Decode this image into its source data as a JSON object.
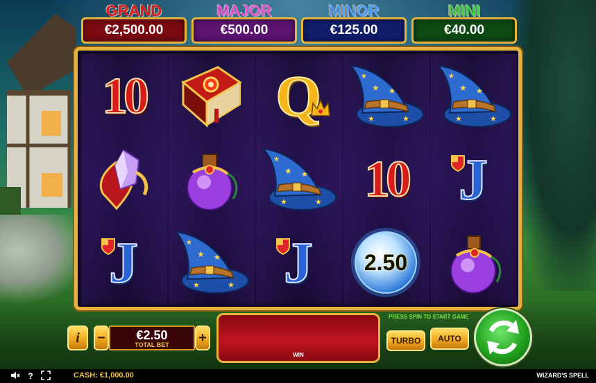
{
  "jackpots": [
    {
      "label": "GRAND",
      "value": "€2,500.00",
      "label_color": "#e02020",
      "box_color": "#7a0a10"
    },
    {
      "label": "MAJOR",
      "value": "€500.00",
      "label_color": "#e05ad8",
      "box_color": "#5c1470"
    },
    {
      "label": "MINOR",
      "value": "€125.00",
      "label_color": "#4aa3ff",
      "box_color": "#101d6a"
    },
    {
      "label": "MINI",
      "value": "€40.00",
      "label_color": "#46d24a",
      "box_color": "#0d4a12"
    }
  ],
  "reels": [
    [
      "10",
      "spellbook",
      "amulet"
    ],
    [
      "spellbook",
      "potion",
      "wizard-hat"
    ],
    [
      "Q",
      "wizard-hat",
      "J"
    ],
    [
      "wizard-hat",
      "10",
      "orb"
    ],
    [
      "wizard-hat",
      "J",
      "potion"
    ]
  ],
  "symbols": {
    "ten": "10",
    "queen": "Q",
    "jack": "J",
    "orb_value": "2.50"
  },
  "controls": {
    "info_label": "i",
    "minus_label": "−",
    "plus_label": "+",
    "total_bet_value": "€2.50",
    "total_bet_label": "TOTAL BET",
    "win_label": "WIN",
    "press_spin_text": "PRESS SPIN TO START GAME",
    "turbo_label": "TURBO",
    "auto_label": "AUTO"
  },
  "status": {
    "cash_label": "CASH:",
    "cash_value": "€1,000.00",
    "game_name": "WIZARD'S SPELL",
    "sound_icon": "sound-off-icon",
    "help_icon": "help-icon",
    "fullscreen_icon": "fullscreen-icon"
  }
}
